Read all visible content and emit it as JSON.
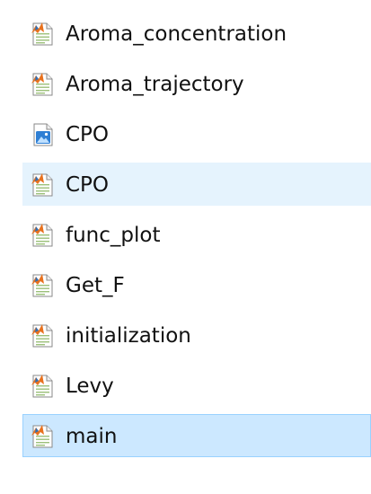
{
  "files": [
    {
      "name": "Aroma_concentration",
      "icon": "matlab-script-icon"
    },
    {
      "name": "Aroma_trajectory",
      "icon": "matlab-script-icon"
    },
    {
      "name": "CPO",
      "icon": "figure-file-icon"
    },
    {
      "name": "CPO",
      "icon": "matlab-script-icon",
      "state": "hover"
    },
    {
      "name": "func_plot",
      "icon": "matlab-script-icon"
    },
    {
      "name": "Get_F",
      "icon": "matlab-script-icon"
    },
    {
      "name": "initialization",
      "icon": "matlab-script-icon"
    },
    {
      "name": "Levy",
      "icon": "matlab-script-icon"
    },
    {
      "name": "main",
      "icon": "matlab-script-icon",
      "state": "selected"
    }
  ],
  "colors": {
    "hover_background": "#e5f3fd",
    "selected_background": "#cce8ff",
    "selected_border": "#99d1ff",
    "matlab_orange": "#e8711d",
    "figure_blue": "#2f7fd4"
  }
}
